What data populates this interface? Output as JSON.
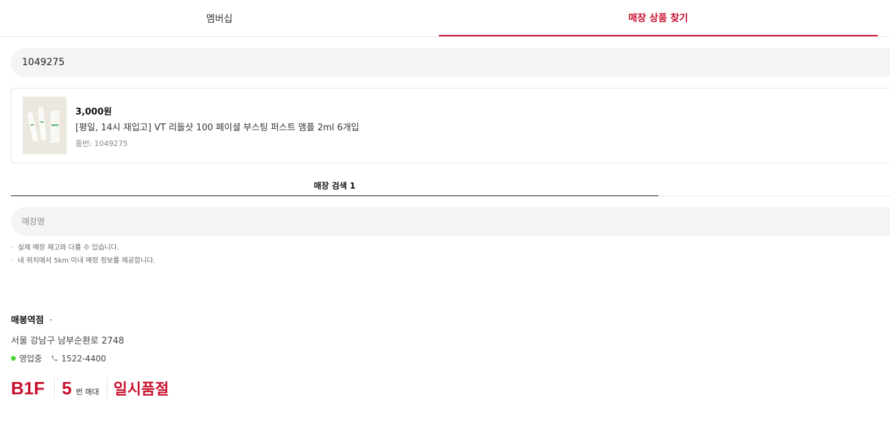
{
  "tabs": {
    "membership": "멤버십",
    "store_product_finder": "매장 상품 찾기"
  },
  "search": {
    "value": "1049275"
  },
  "product": {
    "price": "3,000원",
    "name": "[평일, 14시 재입고] VT 리들샷 100 페이셜 부스팅 퍼스트 앰플 2ml 6개입",
    "code": "품번: 1049275"
  },
  "store_tab": {
    "label": "매장 검색 1"
  },
  "store_search": {
    "placeholder": "매장명"
  },
  "notes": [
    "실제 매장 재고와 다를 수 있습니다.",
    "내 위치에서 5km 이내 매장 정보를 제공합니다."
  ],
  "store": {
    "name": "매봉역점",
    "distance": "-",
    "address": "서울 강남구 남부순환로 2748",
    "status": "영업중",
    "phone": "1522-4400",
    "floor": "B1F",
    "stand_number": "5",
    "stand_label": "번 매대",
    "stock_status": "일시품절"
  },
  "colors": {
    "accent": "#c8102e",
    "open_status": "#4cd137",
    "input_bg": "#f4f4f4"
  }
}
